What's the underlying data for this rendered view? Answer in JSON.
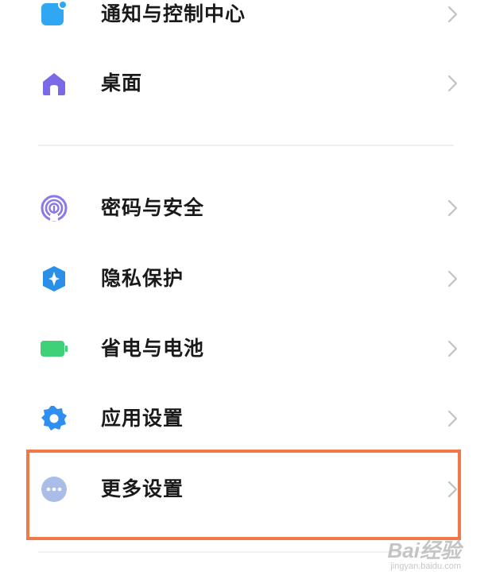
{
  "settings": {
    "items": [
      {
        "label": "通知与控制中心",
        "icon": "notification-icon"
      },
      {
        "label": "桌面",
        "icon": "home-icon"
      },
      {
        "label": "密码与安全",
        "icon": "fingerprint-icon"
      },
      {
        "label": "隐私保护",
        "icon": "privacy-shield-icon"
      },
      {
        "label": "省电与电池",
        "icon": "battery-icon"
      },
      {
        "label": "应用设置",
        "icon": "gear-icon"
      },
      {
        "label": "更多设置",
        "icon": "more-icon"
      }
    ]
  },
  "watermark": {
    "brand": "Bai经验",
    "site": "jingyan.baidu.com"
  },
  "colors": {
    "notification": "#2fa7f3",
    "home": "#7b6ae8",
    "fingerprint": "#8a79e6",
    "privacy": "#2a8fe6",
    "battery": "#3ed178",
    "gear": "#2e8ff0",
    "more": "#a9bde6",
    "highlight": "#f0784a",
    "chevron": "#c2c2c2"
  }
}
